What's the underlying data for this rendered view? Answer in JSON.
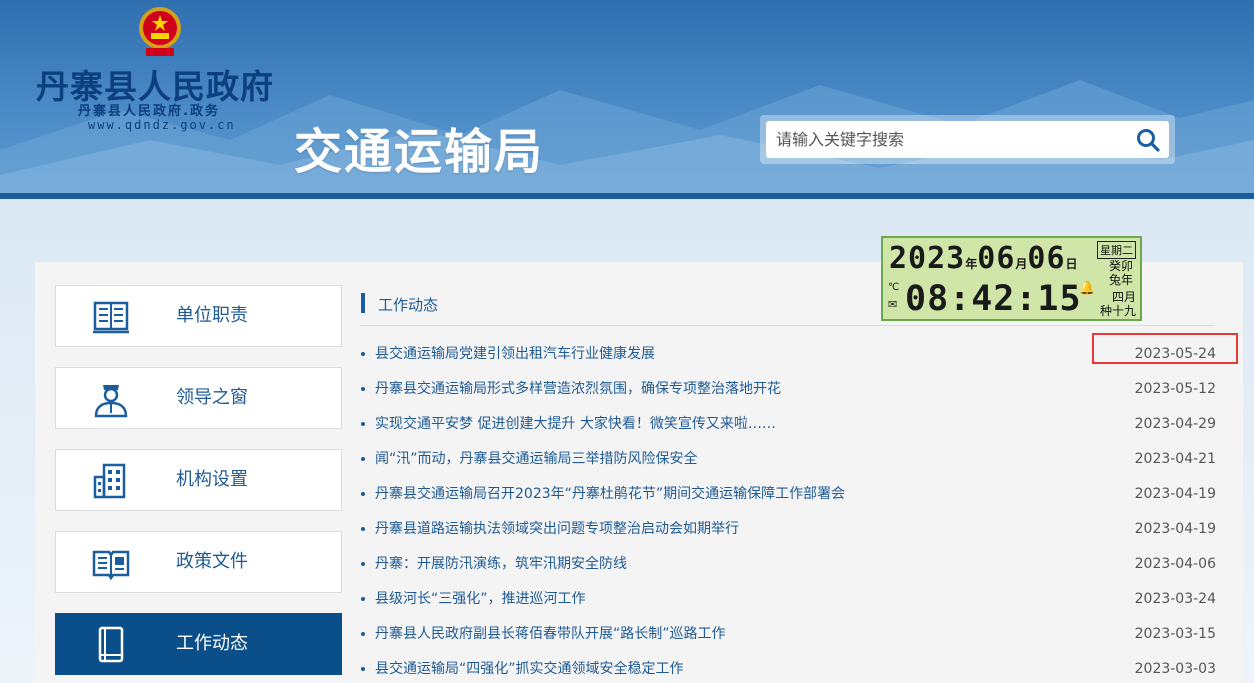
{
  "header": {
    "gov_title": "丹寨县人民政府",
    "gov_subtitle": "丹寨县人民政府.政务",
    "gov_url": "www.qdndz.gov.cn",
    "dept_title": "交通运输局",
    "search_placeholder": "请输入关键字搜索"
  },
  "clock": {
    "year": "2023",
    "month": "06",
    "day": "06",
    "unit_year": "年",
    "unit_month": "月",
    "unit_day": "日",
    "weekday": "星期二",
    "lunar_top": "癸卯",
    "lunar_animal": "兔年",
    "time": "08:42:15",
    "temp_unit": "℃",
    "lunar_month": "四月",
    "lunar_day": "初十九",
    "lunar_day_a": "种十九"
  },
  "sidebar": {
    "items": [
      {
        "label": "单位职责",
        "icon": "document-list-icon"
      },
      {
        "label": "领导之窗",
        "icon": "leader-person-icon"
      },
      {
        "label": "机构设置",
        "icon": "building-icon"
      },
      {
        "label": "政策文件",
        "icon": "open-book-icon"
      },
      {
        "label": "工作动态",
        "icon": "notebook-icon",
        "active": true
      }
    ]
  },
  "section": {
    "title": "工作动态"
  },
  "news": [
    {
      "title": "县交通运输局党建引领出租汽车行业健康发展",
      "date": "2023-05-24"
    },
    {
      "title": "丹寨县交通运输局形式多样营造浓烈氛围，确保专项整治落地开花",
      "date": "2023-05-12"
    },
    {
      "title": "实现交通平安梦 促进创建大提升  大家快看！微笑宣传又来啦……",
      "date": "2023-04-29"
    },
    {
      "title": "闻“汛”而动，丹寨县交通运输局三举措防风险保安全",
      "date": "2023-04-21"
    },
    {
      "title": "丹寨县交通运输局召开2023年“丹寨杜鹃花节”期间交通运输保障工作部署会",
      "date": "2023-04-19"
    },
    {
      "title": "丹寨县道路运输执法领域突出问题专项整治启动会如期举行",
      "date": "2023-04-19"
    },
    {
      "title": "丹寨：开展防汛演练，筑牢汛期安全防线",
      "date": "2023-04-06"
    },
    {
      "title": "县级河长“三强化”，推进巡河工作",
      "date": "2023-03-24"
    },
    {
      "title": "丹寨县人民政府副县长蒋佰春带队开展“路长制”巡路工作",
      "date": "2023-03-15"
    },
    {
      "title": "县交通运输局“四强化”抓实交通领域安全稳定工作",
      "date": "2023-03-03"
    }
  ],
  "colors": {
    "primary": "#1c5d9e",
    "sidebar_active": "#0b4f8a",
    "link": "#1f5a94",
    "highlight": "#e53935"
  }
}
